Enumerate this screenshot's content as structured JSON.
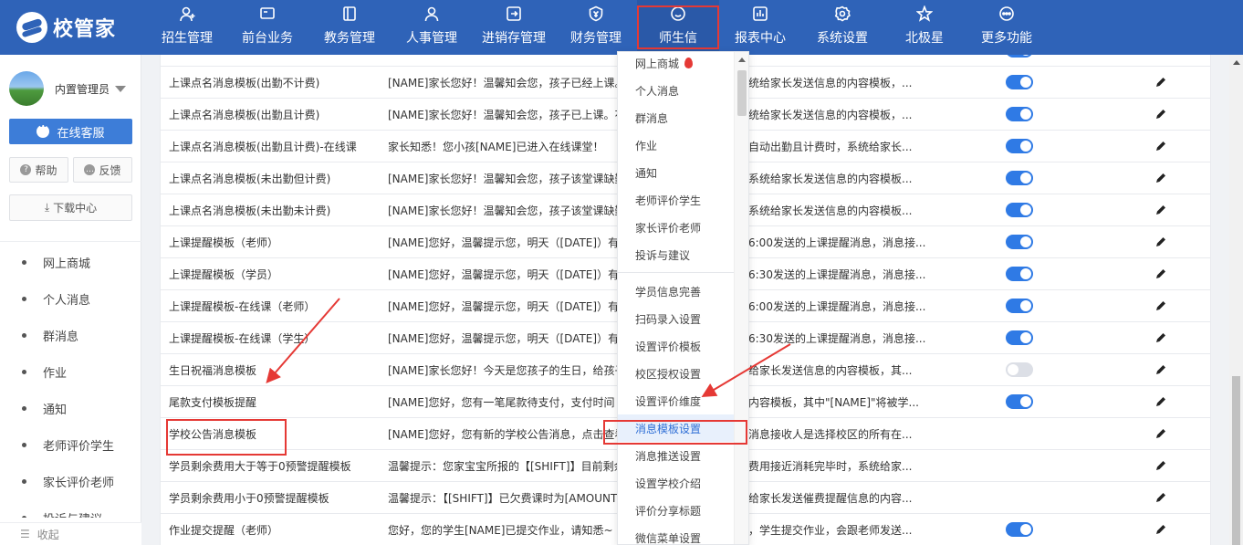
{
  "app": {
    "logo_text": "校管家"
  },
  "nav": [
    {
      "label": "招生管理",
      "icon": "person-add-icon"
    },
    {
      "label": "前台业务",
      "icon": "monitor-icon"
    },
    {
      "label": "教务管理",
      "icon": "book-icon"
    },
    {
      "label": "人事管理",
      "icon": "person-icon"
    },
    {
      "label": "进销存管理",
      "icon": "box-arrow-icon"
    },
    {
      "label": "财务管理",
      "icon": "money-shield-icon"
    },
    {
      "label": "师生信",
      "icon": "smile-icon"
    },
    {
      "label": "报表中心",
      "icon": "chart-icon"
    },
    {
      "label": "系统设置",
      "icon": "gear-icon"
    },
    {
      "label": "北极星",
      "icon": "star-icon"
    },
    {
      "label": "更多功能",
      "icon": "more-icon"
    }
  ],
  "sidebar": {
    "user_name": "内置管理员",
    "service_label": "在线客服",
    "help_label": "帮助",
    "feedback_label": "反馈",
    "download_label": "下载中心",
    "collapse_label": "收起",
    "items": [
      {
        "label": "网上商城"
      },
      {
        "label": "个人消息"
      },
      {
        "label": "群消息"
      },
      {
        "label": "作业"
      },
      {
        "label": "通知"
      },
      {
        "label": "老师评价学生"
      },
      {
        "label": "家长评价老师"
      },
      {
        "label": "投诉与建议"
      }
    ]
  },
  "table": {
    "rows": [
      {
        "name": "",
        "content": "",
        "desc": "",
        "enabled": true
      },
      {
        "name": "上课点名消息模板(出勤不计费)",
        "content": "[NAME]家长您好！温馨知会您，孩子已经上课。",
        "desc": "统给家长发送信息的内容模板，...",
        "enabled": true
      },
      {
        "name": "上课点名消息模板(出勤且计费)",
        "content": "[NAME]家长您好！温馨知会您，孩子已上课。花费",
        "desc": "统给家长发送信息的内容模板，...",
        "enabled": true
      },
      {
        "name": "上课点名消息模板(出勤且计费)-在线课",
        "content": "家长知悉！您小孩[NAME]已进入在线课堂！",
        "desc": "自动出勤且计费时，系统给家长...",
        "enabled": true
      },
      {
        "name": "上课点名消息模板(未出勤但计费)",
        "content": "[NAME]家长您好！温馨知会您，孩子该堂课缺勤",
        "desc": "系统给家长发送信息的内容模板...",
        "enabled": true
      },
      {
        "name": "上课点名消息模板(未出勤未计费)",
        "content": "[NAME]家长您好！温馨知会您，孩子该堂课缺勤",
        "desc": "系统给家长发送信息的内容模板...",
        "enabled": true
      },
      {
        "name": "上课提醒模板（老师）",
        "content": "[NAME]您好，温馨提示您，明天（[DATE]）有",
        "desc": "6:00发送的上课提醒消息，消息接...",
        "enabled": true
      },
      {
        "name": "上课提醒模板（学员）",
        "content": "[NAME]您好，温馨提示您，明天（[DATE]）有",
        "desc": "6:30发送的上课提醒消息，消息接...",
        "enabled": true
      },
      {
        "name": "上课提醒模板-在线课（老师）",
        "content": "[NAME]您好，温馨提示您，明天（[DATE]）有",
        "desc": "6:00发送的上课提醒消息，消息接...",
        "enabled": true
      },
      {
        "name": "上课提醒模板-在线课（学生）",
        "content": "[NAME]您好，温馨提示您，明天（[DATE]）有",
        "desc": "6:30发送的上课提醒消息，消息接...",
        "enabled": true
      },
      {
        "name": "生日祝福消息模板",
        "content": "[NAME]家长您好！今天是您孩子的生日，给孩子",
        "desc": "给家长发送信息的内容模板，其...",
        "enabled": false
      },
      {
        "name": "尾款支付模板提醒",
        "content": "[NAME]您好，您有一笔尾款待支付，支付时间",
        "desc": "内容模板，其中\"[NAME]\"将被学...",
        "enabled": true
      },
      {
        "name": "学校公告消息模板",
        "content": "[NAME]您好，您有新的学校公告消息，点击查看",
        "desc": "消息接收人是选择校区的所有在...",
        "enabled": null
      },
      {
        "name": "学员剩余费用大于等于0预警提醒模板",
        "content": "温馨提示：您家宝宝所报的【[SHIFT]】目前剩余",
        "desc": "费用接近消耗完毕时，系统给家...",
        "enabled": null
      },
      {
        "name": "学员剩余费用小于0预警提醒模板",
        "content": "温馨提示：【[SHIFT]】已欠费课时为[AMOUNT]",
        "desc": "给家长发送催费提醒信息的内容...",
        "enabled": null
      },
      {
        "name": "作业提交提醒（老师）",
        "content": "您好，您的学生[NAME]已提交作业，请知悉~",
        "desc": "，学生提交作业，会跟老师发送...",
        "enabled": true
      }
    ]
  },
  "dropdown": {
    "group1": [
      {
        "label": "网上商城",
        "hot": true
      },
      {
        "label": "个人消息"
      },
      {
        "label": "群消息"
      },
      {
        "label": "作业"
      },
      {
        "label": "通知"
      },
      {
        "label": "老师评价学生"
      },
      {
        "label": "家长评价老师"
      },
      {
        "label": "投诉与建议"
      }
    ],
    "group2": [
      {
        "label": "学员信息完善"
      },
      {
        "label": "扫码录入设置"
      },
      {
        "label": "设置评价模板"
      },
      {
        "label": "校区授权设置"
      },
      {
        "label": "设置评价维度"
      },
      {
        "label": "消息模板设置",
        "active": true
      },
      {
        "label": "消息推送设置"
      },
      {
        "label": "设置学校介绍"
      },
      {
        "label": "评价分享标题"
      },
      {
        "label": "微信菜单设置"
      }
    ]
  },
  "colors": {
    "topbar": "#2f63b8",
    "accent": "#2f7ae5",
    "annotation": "#e53935"
  }
}
